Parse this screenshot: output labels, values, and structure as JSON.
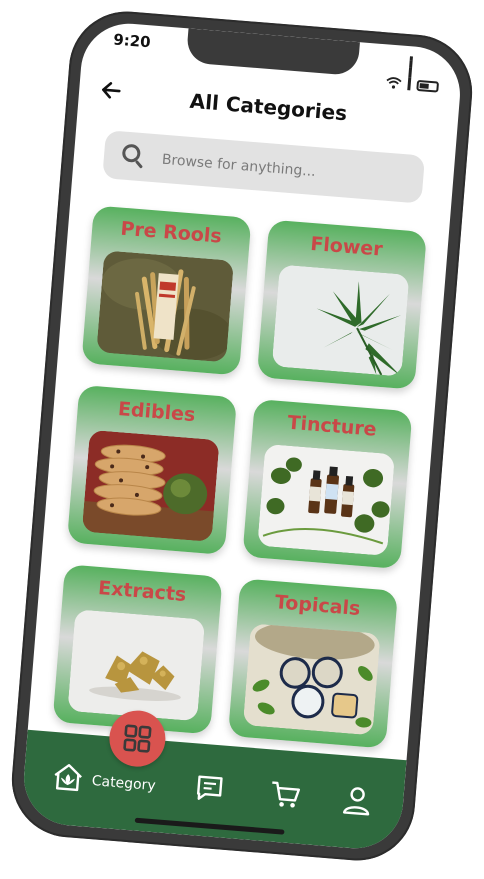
{
  "status_bar": {
    "time": "9:20"
  },
  "header": {
    "back_icon": "arrow-left-icon",
    "title": "All Categories"
  },
  "search": {
    "placeholder": "Browse for anything...",
    "value": ""
  },
  "categories": [
    {
      "label": "Pre Rools"
    },
    {
      "label": "Flower"
    },
    {
      "label": "Edibles"
    },
    {
      "label": "Tincture"
    },
    {
      "label": "Extracts"
    },
    {
      "label": "Topicals"
    }
  ],
  "nav": {
    "items": [
      {
        "icon": "home-leaf-icon"
      },
      {
        "icon": "grid-icon",
        "label": "Category",
        "active": true
      },
      {
        "icon": "chat-icon"
      },
      {
        "icon": "cart-icon"
      },
      {
        "icon": "user-icon"
      }
    ]
  },
  "colors": {
    "nav_bg": "#2e6a3e",
    "card_green": "#58b15f",
    "label_red": "#c94848",
    "active_bubble": "#d9534f"
  }
}
